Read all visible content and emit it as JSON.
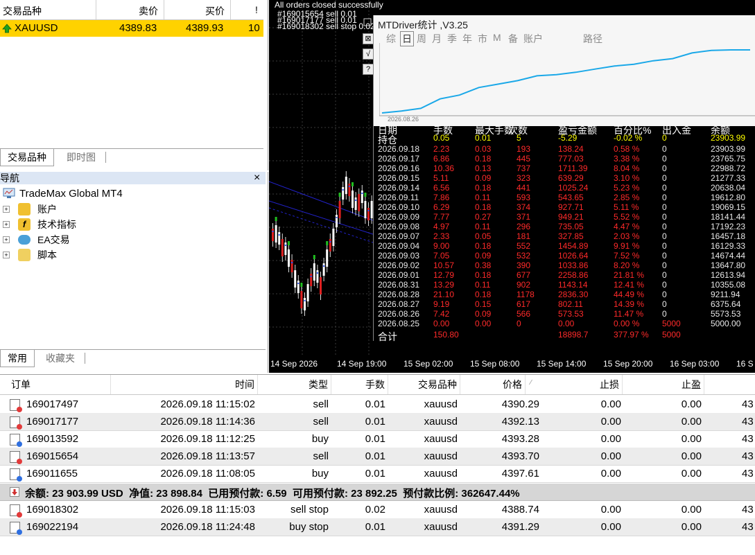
{
  "market_watch": {
    "columns": [
      "交易品种",
      "卖价",
      "买价",
      "!"
    ],
    "row": {
      "symbol": "XAUUSD",
      "bid": "4389.83",
      "ask": "4389.93",
      "spread": "10"
    },
    "tabs": [
      "交易品种",
      "即时图"
    ]
  },
  "navigator": {
    "title": "导航",
    "close": "×",
    "root": "TradeMax Global MT4",
    "items": [
      "账户",
      "技术指标",
      "EA交易",
      "脚本"
    ],
    "tabs": [
      "常用",
      "收藏夹"
    ]
  },
  "chart": {
    "log_lines": [
      "All orders closed successfully",
      "#169015654 sell 0.01",
      "#169017177 sell 0.01",
      "#169018302 sell stop 0.02"
    ],
    "x_labels": [
      "14 Sep 2026",
      "14 Sep 19:00",
      "15 Sep 02:00",
      "15 Sep 08:00",
      "15 Sep 14:00",
      "15 Sep 20:00",
      "16 Sep 03:00",
      "16 S"
    ]
  },
  "dashboard": {
    "title": "MTDriver统计 ,V3.25",
    "menu": [
      "综",
      "日",
      "周",
      "月",
      "季",
      "年",
      "市",
      "M",
      "备",
      "账户",
      "路径"
    ],
    "side_buttons": [
      "⊠",
      "√",
      "?"
    ],
    "curve_start_label": "2026.08.26",
    "curve_values": [
      5000,
      5573.53,
      6375.64,
      9211.94,
      10355.08,
      12613.94,
      13647.8,
      14674.44,
      16129.33,
      16457.18,
      17192.23,
      18141.44,
      19069.15,
      19612.8,
      20638.04,
      21277.33,
      22988.72,
      23765.75,
      23903.99,
      23903.99
    ],
    "headers": [
      "日期",
      "手数",
      "最大手数",
      "次数",
      "盈亏金额",
      "百分比%",
      "出入金",
      "余额"
    ],
    "position_row": [
      "持仓",
      "0.05",
      "0.01",
      "5",
      "-5.29",
      "-0.02 %",
      "0",
      "23903.99"
    ],
    "rows": [
      [
        "2026.09.18",
        "2.23",
        "0.03",
        "193",
        "138.24",
        "0.58 %",
        "0",
        "23903.99"
      ],
      [
        "2026.09.17",
        "6.86",
        "0.18",
        "445",
        "777.03",
        "3.38 %",
        "0",
        "23765.75"
      ],
      [
        "2026.09.16",
        "10.36",
        "0.13",
        "737",
        "1711.39",
        "8.04 %",
        "0",
        "22988.72"
      ],
      [
        "2026.09.15",
        "5.11",
        "0.09",
        "323",
        "639.29",
        "3.10 %",
        "0",
        "21277.33"
      ],
      [
        "2026.09.14",
        "6.56",
        "0.18",
        "441",
        "1025.24",
        "5.23 %",
        "0",
        "20638.04"
      ],
      [
        "2026.09.11",
        "7.86",
        "0.11",
        "593",
        "543.65",
        "2.85 %",
        "0",
        "19612.80"
      ],
      [
        "2026.09.10",
        "6.29",
        "0.18",
        "374",
        "927.71",
        "5.11 %",
        "0",
        "19069.15"
      ],
      [
        "2026.09.09",
        "7.77",
        "0.27",
        "371",
        "949.21",
        "5.52 %",
        "0",
        "18141.44"
      ],
      [
        "2026.09.08",
        "4.97",
        "0.11",
        "296",
        "735.05",
        "4.47 %",
        "0",
        "17192.23"
      ],
      [
        "2026.09.07",
        "2.33",
        "0.05",
        "181",
        "327.85",
        "2.03 %",
        "0",
        "16457.18"
      ],
      [
        "2026.09.04",
        "9.00",
        "0.18",
        "552",
        "1454.89",
        "9.91 %",
        "0",
        "16129.33"
      ],
      [
        "2026.09.03",
        "7.05",
        "0.09",
        "532",
        "1026.64",
        "7.52 %",
        "0",
        "14674.44"
      ],
      [
        "2026.09.02",
        "10.57",
        "0.38",
        "390",
        "1033.86",
        "8.20 %",
        "0",
        "13647.80"
      ],
      [
        "2026.09.01",
        "12.79",
        "0.18",
        "677",
        "2258.86",
        "21.81 %",
        "0",
        "12613.94"
      ],
      [
        "2026.08.31",
        "13.29",
        "0.11",
        "902",
        "1143.14",
        "12.41 %",
        "0",
        "10355.08"
      ],
      [
        "2026.08.28",
        "21.10",
        "0.18",
        "1178",
        "2836.30",
        "44.49 %",
        "0",
        "9211.94"
      ],
      [
        "2026.08.27",
        "9.19",
        "0.15",
        "617",
        "802.11",
        "14.39 %",
        "0",
        "6375.64"
      ],
      [
        "2026.08.26",
        "7.42",
        "0.09",
        "566",
        "573.53",
        "11.47 %",
        "0",
        "5573.53"
      ],
      [
        "2026.08.25",
        "0.00",
        "0.00",
        "0",
        "0.00",
        "0.00 %",
        "5000",
        "5000.00"
      ]
    ],
    "total_row": [
      "合计",
      "150.80",
      "",
      "",
      "18898.7",
      "377.97 %",
      "5000",
      ""
    ]
  },
  "orders": {
    "columns": [
      "订单",
      "时间",
      "类型",
      "手数",
      "交易品种",
      "价格",
      "止损",
      "止盈"
    ],
    "rows": [
      {
        "id": "169017497",
        "time": "2026.09.18 11:15:02",
        "type": "sell",
        "lots": "0.01",
        "symbol": "xauusd",
        "price": "4390.29",
        "sl": "0.00",
        "tp": "0.00",
        "cur": "43",
        "color": "#e23a3a"
      },
      {
        "id": "169017177",
        "time": "2026.09.18 11:14:36",
        "type": "sell",
        "lots": "0.01",
        "symbol": "xauusd",
        "price": "4392.13",
        "sl": "0.00",
        "tp": "0.00",
        "cur": "43",
        "color": "#e23a3a"
      },
      {
        "id": "169013592",
        "time": "2026.09.18 11:12:25",
        "type": "buy",
        "lots": "0.01",
        "symbol": "xauusd",
        "price": "4393.28",
        "sl": "0.00",
        "tp": "0.00",
        "cur": "43",
        "color": "#2f6fe0"
      },
      {
        "id": "169015654",
        "time": "2026.09.18 11:13:57",
        "type": "sell",
        "lots": "0.01",
        "symbol": "xauusd",
        "price": "4393.70",
        "sl": "0.00",
        "tp": "0.00",
        "cur": "43",
        "color": "#e23a3a"
      },
      {
        "id": "169011655",
        "time": "2026.09.18 11:08:05",
        "type": "buy",
        "lots": "0.01",
        "symbol": "xauusd",
        "price": "4397.61",
        "sl": "0.00",
        "tp": "0.00",
        "cur": "43",
        "color": "#2f6fe0"
      }
    ],
    "balance_line": "余额: 23 903.99 USD  净值: 23 898.84  已用预付款: 6.59  可用预付款: 23 892.25  预付款比例: 362647.44%",
    "pending_rows": [
      {
        "id": "169018302",
        "time": "2026.09.18 11:15:03",
        "type": "sell stop",
        "lots": "0.02",
        "symbol": "xauusd",
        "price": "4388.74",
        "sl": "0.00",
        "tp": "0.00",
        "cur": "43",
        "color": "#e23a3a"
      },
      {
        "id": "169022194",
        "time": "2026.09.18 11:24:48",
        "type": "buy stop",
        "lots": "0.01",
        "symbol": "xauusd",
        "price": "4391.29",
        "sl": "0.00",
        "tp": "0.00",
        "cur": "43",
        "color": "#2f6fe0"
      }
    ]
  }
}
